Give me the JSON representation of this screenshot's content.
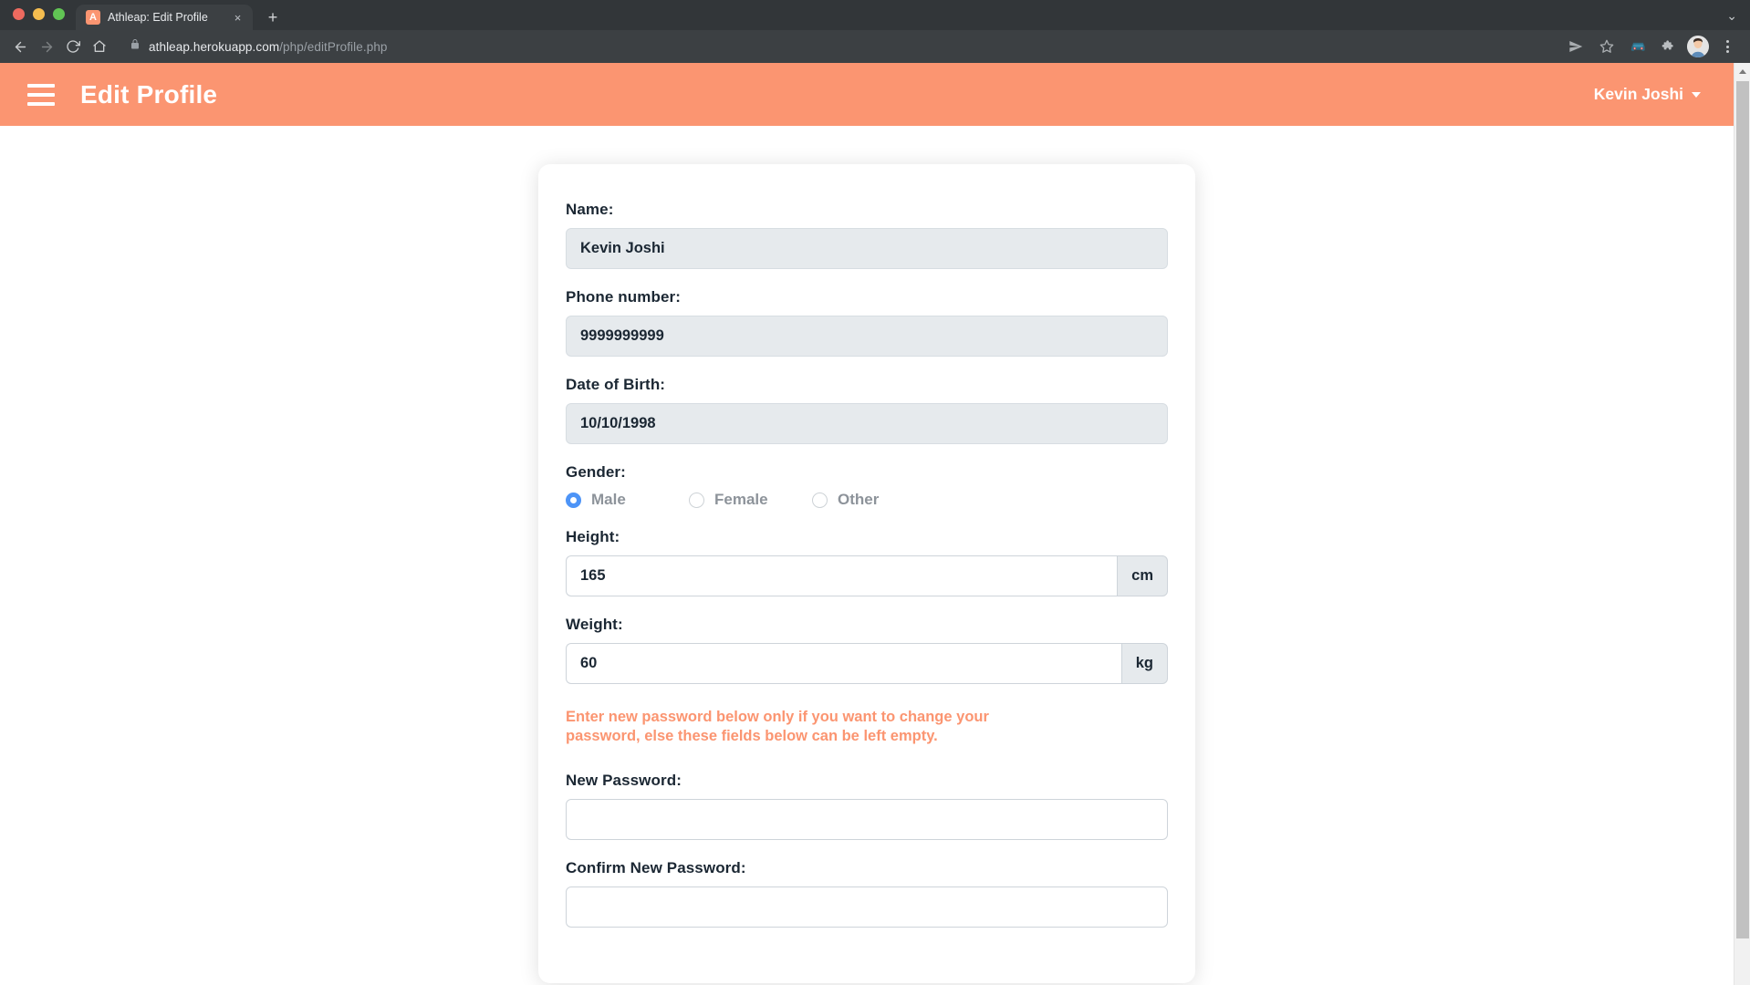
{
  "browser": {
    "tab": {
      "favicon_letter": "A",
      "title": "Athleap: Edit Profile",
      "close_icon": "×"
    },
    "new_tab_label": "+",
    "window_minimize_label": "⌄",
    "toolbar": {
      "back_icon": "←",
      "forward_icon": "→",
      "reload_icon": "⟳",
      "home_icon": "⌂",
      "lock_icon": "🔒",
      "url_domain": "athleap.herokuapp.com",
      "url_path": "/php/editProfile.php",
      "share_icon": "➤",
      "bookmark_icon": "☆",
      "extension_icon": "🚗",
      "puzzle_icon": "🧩",
      "avatar_icon": "👤",
      "menu_icon": "⋮"
    }
  },
  "app": {
    "header": {
      "menu_icon": "hamburger-icon",
      "title": "Edit Profile",
      "user_name": "Kevin Joshi",
      "caret_icon": "chevron-down-icon"
    },
    "brand_color": "#fb9571",
    "accent_blue": "#4d94f7"
  },
  "form": {
    "fields": [
      {
        "label": "Name:",
        "value": "Kevin Joshi",
        "disabled": true
      },
      {
        "label": "Phone number:",
        "value": "9999999999",
        "disabled": true
      },
      {
        "label": "Date of Birth:",
        "value": "10/10/1998",
        "disabled": true
      }
    ],
    "gender": {
      "label": "Gender:",
      "options": [
        {
          "label": "Male",
          "checked": true
        },
        {
          "label": "Female",
          "checked": false
        },
        {
          "label": "Other",
          "checked": false
        }
      ]
    },
    "height": {
      "label": "Height:",
      "value": "165",
      "unit": "cm"
    },
    "weight": {
      "label": "Weight:",
      "value": "60",
      "unit": "kg"
    },
    "password_notice": "Enter new password below only if you want to change your password, else these fields below can be left empty.",
    "new_password": {
      "label": "New Password:",
      "value": "",
      "placeholder": ""
    },
    "confirm_password": {
      "label": "Confirm New Password:",
      "value": "",
      "placeholder": ""
    }
  }
}
